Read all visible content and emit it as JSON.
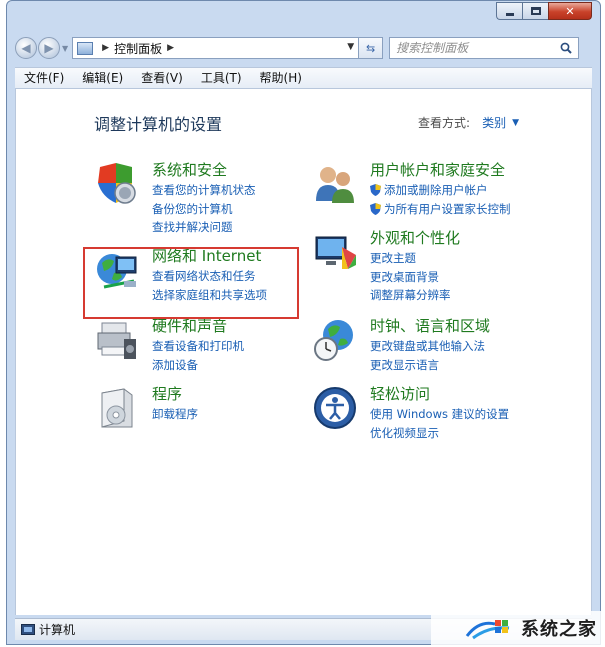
{
  "window": {
    "colors": {
      "frame": "#c9daf0",
      "close_button": "#c9422a",
      "link": "#1a5fb4",
      "category_title": "#1f7a1f",
      "highlight_box": "#d63a31"
    }
  },
  "address": {
    "breadcrumb": "控制面板",
    "search_placeholder": "搜索控制面板"
  },
  "menu": {
    "items": [
      "文件(F)",
      "编辑(E)",
      "查看(V)",
      "工具(T)",
      "帮助(H)"
    ]
  },
  "main": {
    "title": "调整计算机的设置",
    "view_by_label": "查看方式:",
    "view_by_value": "类别"
  },
  "categories": {
    "left": [
      {
        "title": "系统和安全",
        "icon": "system-security-icon",
        "links": [
          "查看您的计算机状态",
          "备份您的计算机",
          "查找并解决问题"
        ]
      },
      {
        "title": "网络和 Internet",
        "icon": "network-internet-icon",
        "links": [
          "查看网络状态和任务",
          "选择家庭组和共享选项"
        ]
      },
      {
        "title": "硬件和声音",
        "icon": "hardware-sound-icon",
        "links": [
          "查看设备和打印机",
          "添加设备"
        ]
      },
      {
        "title": "程序",
        "icon": "programs-icon",
        "links": [
          "卸载程序"
        ]
      }
    ],
    "right": [
      {
        "title": "用户帐户和家庭安全",
        "icon": "user-accounts-icon",
        "links": [
          "添加或删除用户帐户",
          "为所有用户设置家长控制"
        ]
      },
      {
        "title": "外观和个性化",
        "icon": "appearance-icon",
        "links": [
          "更改主题",
          "更改桌面背景",
          "调整屏幕分辨率"
        ]
      },
      {
        "title": "时钟、语言和区域",
        "icon": "clock-language-icon",
        "links": [
          "更改键盘或其他输入法",
          "更改显示语言"
        ]
      },
      {
        "title": "轻松访问",
        "icon": "ease-of-access-icon",
        "links": [
          "使用 Windows 建议的设置",
          "优化视频显示"
        ]
      }
    ]
  },
  "status": {
    "text": "计算机"
  },
  "watermark": {
    "text": "系统之家"
  }
}
